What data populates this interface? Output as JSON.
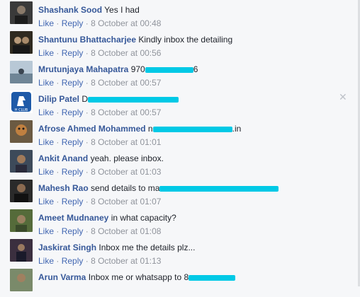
{
  "actions": {
    "like": "Like",
    "reply": "Reply",
    "separator": "·"
  },
  "close_glyph": "✕",
  "comments": [
    {
      "author": "Shashank Sood",
      "text": "Yes I had",
      "time": "8 October at 00:48",
      "avatar_icon": "user-photo-icon",
      "avatar_color": "#3a3a3a"
    },
    {
      "author": "Shantunu Bhattacharjee",
      "text": "Kindly inbox the detailing",
      "time": "8 October at 00:56",
      "avatar_icon": "user-photo-icon",
      "avatar_color": "#2f2a20"
    },
    {
      "author": "Mrutunjaya Mahapatra",
      "text": "970",
      "text_after": "6",
      "time": "8 October at 00:57",
      "avatar_icon": "user-photo-icon",
      "avatar_color": "#8fa6b8"
    },
    {
      "author": "Dilip Patel",
      "text": "D",
      "time": "8 October at 00:57",
      "avatar_icon": "club-logo-icon",
      "avatar_color": "#1e5aa8",
      "logo_text": "H CLUB"
    },
    {
      "author": "Afrose Ahmed Mohammed",
      "text": "n",
      "text_after": ".in",
      "time": "8 October at 01:01",
      "avatar_icon": "user-photo-icon",
      "avatar_color": "#6b5a42"
    },
    {
      "author": "Ankit Anand",
      "text": "yeah. please inbox.",
      "time": "8 October at 01:03",
      "avatar_icon": "user-photo-icon",
      "avatar_color": "#3d4a5a"
    },
    {
      "author": "Mahesh Rao",
      "text": "send details to ma",
      "time": "8 October at 01:07",
      "avatar_icon": "user-photo-icon",
      "avatar_color": "#2a2a2a"
    },
    {
      "author": "Ameet Mudnaney",
      "text": "in what capacity?",
      "time": "8 October at 01:08",
      "avatar_icon": "user-photo-icon",
      "avatar_color": "#556b3a"
    },
    {
      "author": "Jaskirat Singh",
      "text": "Inbox me the details plz...",
      "time": "8 October at 01:13",
      "avatar_icon": "user-photo-icon",
      "avatar_color": "#3b2f3f"
    },
    {
      "author": "Arun Varma",
      "text": "Inbox me or whatsapp to 8",
      "time": "",
      "avatar_icon": "user-photo-icon",
      "avatar_color": "#7a8a6a"
    }
  ]
}
